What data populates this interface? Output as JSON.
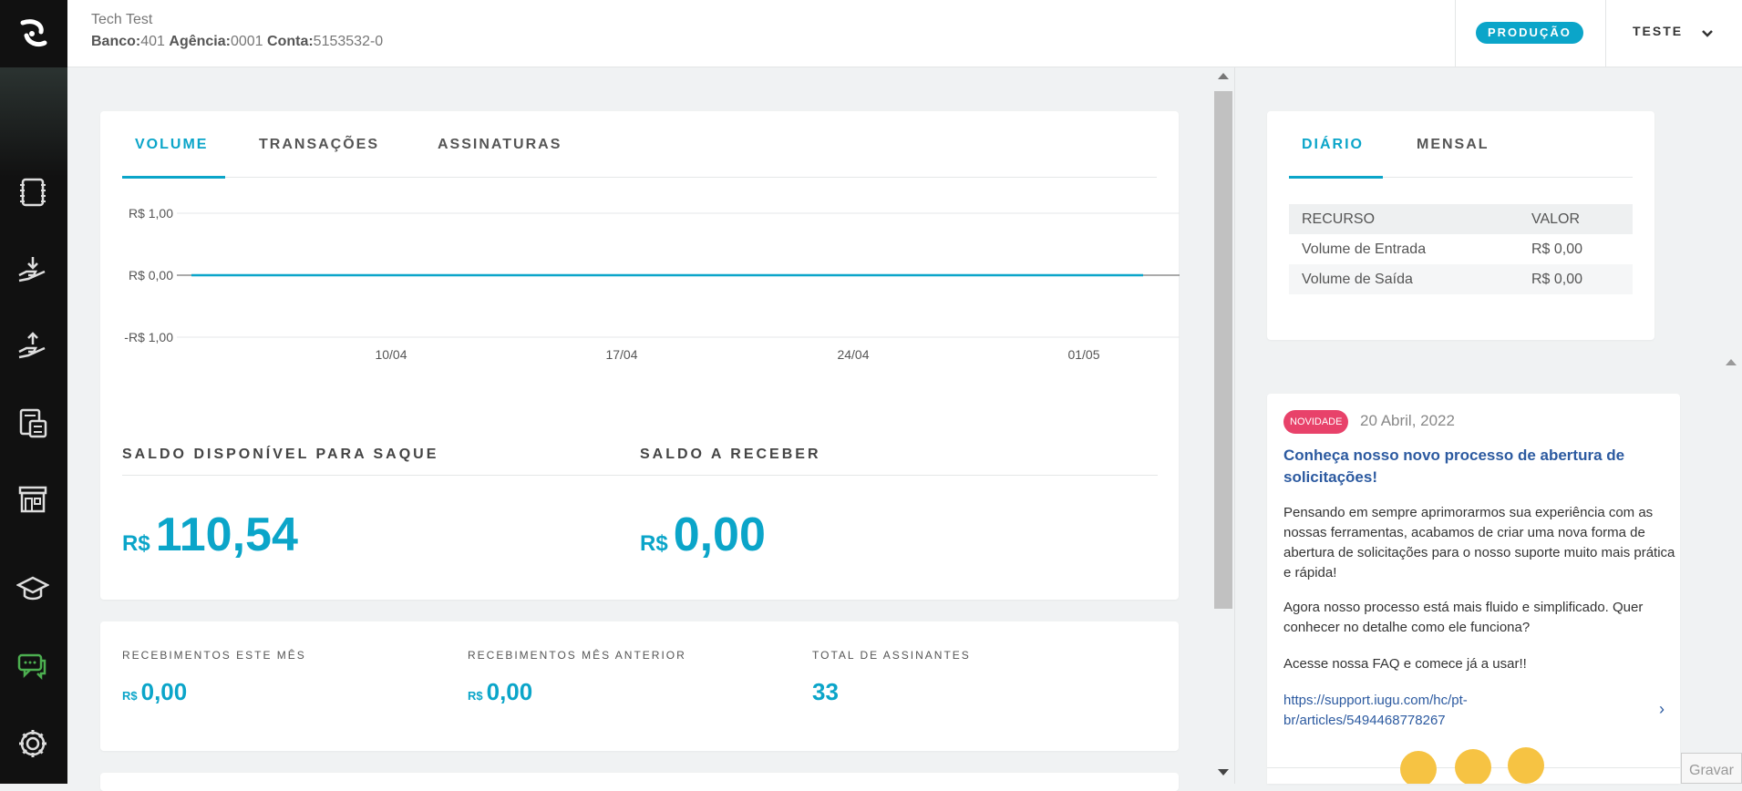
{
  "header": {
    "account_name": "Tech Test",
    "bank_label": "Banco:",
    "bank_value": "401",
    "agency_label": "Agência:",
    "agency_value": "0001",
    "account_label": "Conta:",
    "account_value": "5153532-0",
    "environment": "PRODUÇÃO",
    "user": "TESTE"
  },
  "sidebar": {
    "items": [
      {
        "icon": "ledger-icon"
      },
      {
        "icon": "receive-money-icon"
      },
      {
        "icon": "send-money-icon"
      },
      {
        "icon": "calculator-icon"
      },
      {
        "icon": "store-icon"
      },
      {
        "icon": "graduation-cap-icon"
      },
      {
        "icon": "chat-icon"
      },
      {
        "icon": "gear-icon"
      }
    ]
  },
  "main": {
    "tabs": [
      "VOLUME",
      "TRANSAÇÕES",
      "ASSINATURAS"
    ],
    "active_tab": 0,
    "balance": {
      "available_title": "SALDO DISPONÍVEL PARA SAQUE",
      "available_currency": "R$",
      "available_value": "110,54",
      "receivable_title": "SALDO A RECEBER",
      "receivable_currency": "R$",
      "receivable_value": "0,00"
    },
    "stats": [
      {
        "label": "RECEBIMENTOS ESTE MÊS",
        "currency": "R$",
        "value": "0,00"
      },
      {
        "label": "RECEBIMENTOS MÊS ANTERIOR",
        "currency": "R$",
        "value": "0,00"
      },
      {
        "label": "TOTAL DE ASSINANTES",
        "currency": "",
        "value": "33"
      }
    ]
  },
  "chart_data": {
    "type": "line",
    "x_ticks": [
      "10/04",
      "17/04",
      "24/04",
      "01/05"
    ],
    "y_ticks": [
      "R$ 1,00",
      "R$ 0,00",
      "-R$ 1,00"
    ],
    "ylim": [
      -1,
      1
    ],
    "series": [
      {
        "values": [
          0,
          0,
          0,
          0,
          0,
          0,
          0,
          0,
          0,
          0,
          0,
          0,
          0,
          0,
          0,
          0,
          0,
          0,
          0,
          0,
          0,
          0,
          0,
          0,
          0,
          0,
          0,
          0,
          0
        ]
      }
    ],
    "color": "#0ba5c9"
  },
  "right": {
    "tabs": [
      "DIÁRIO",
      "MENSAL"
    ],
    "active_tab": 0,
    "table": {
      "headers": [
        "RECURSO",
        "VALOR"
      ],
      "rows": [
        [
          "Volume de Entrada",
          "R$ 0,00"
        ],
        [
          "Volume de Saída",
          "R$ 0,00"
        ]
      ]
    },
    "news": {
      "badge": "NOVIDADE",
      "date": "20 Abril, 2022",
      "title": "Conheça nosso novo processo de abertura de solicitações!",
      "p1": "Pensando em sempre aprimorarmos sua experiência com as nossas ferramentas, acabamos de criar uma nova forma de abertura de solicitações para o nosso suporte muito mais prática e rápida!",
      "p2": "Agora nosso processo está mais fluido e simplificado. Quer conhecer no detalhe como ele funciona?",
      "p3": "Acesse nossa FAQ e comece já a usar!!",
      "link": "https://support.iugu.com/hc/pt-br/articles/5494468778267"
    }
  },
  "gravar": "Gravar"
}
